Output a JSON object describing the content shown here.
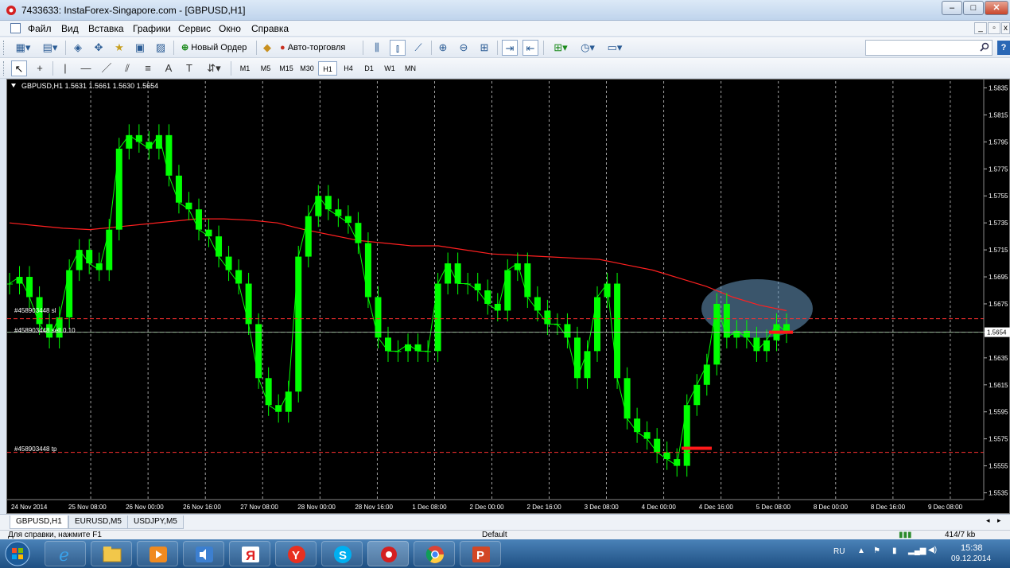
{
  "window": {
    "title": "7433633: InstaForex-Singapore.com - [GBPUSD,H1]"
  },
  "menu": {
    "items": [
      "Файл",
      "Вид",
      "Вставка",
      "Графики",
      "Сервис",
      "Окно",
      "Справка"
    ]
  },
  "toolbar": {
    "new_order": "Новый Ордер",
    "auto_trading": "Авто-торговля"
  },
  "timeframes": [
    "M1",
    "M5",
    "M15",
    "M30",
    "H1",
    "H4",
    "D1",
    "W1",
    "MN"
  ],
  "active_timeframe": "H1",
  "search": {
    "value": ""
  },
  "chart": {
    "header": "GBPUSD,H1  1.5631 1.5661 1.5630 1.5654",
    "current_price": "1.5654",
    "order_lines": {
      "sl_label": "#458903448 sl",
      "entry_label": "#458903448 sell 0.10",
      "tp_label": "#458903448 tp"
    },
    "colors": {
      "background": "#000000",
      "candles": "#00ff00",
      "moving_average": "#ff2020",
      "order_lines": "#ff3030",
      "bid_line": "#c0c0c0",
      "grid": "#c8c8c8",
      "highlight": "#6a9ac2"
    }
  },
  "chart_data": {
    "type": "line",
    "symbol": "GBPUSD",
    "timeframe": "H1",
    "y_ticks": [
      "1.5835",
      "1.5815",
      "1.5795",
      "1.5775",
      "1.5755",
      "1.5735",
      "1.5715",
      "1.5695",
      "1.5675",
      "1.5654",
      "1.5635",
      "1.5615",
      "1.5595",
      "1.5575",
      "1.5555",
      "1.5535"
    ],
    "x_ticks": [
      "24 Nov 2014",
      "25 Nov 08:00",
      "26 Nov 00:00",
      "26 Nov 16:00",
      "27 Nov 08:00",
      "28 Nov 00:00",
      "28 Nov 16:00",
      "1 Dec 08:00",
      "2 Dec 00:00",
      "2 Dec 16:00",
      "3 Dec 08:00",
      "4 Dec 00:00",
      "4 Dec 16:00",
      "5 Dec 08:00",
      "8 Dec 00:00",
      "8 Dec 16:00",
      "9 Dec 08:00"
    ],
    "ylim": [
      1.553,
      1.584
    ],
    "price_series": [
      1.569,
      1.5695,
      1.568,
      1.566,
      1.565,
      1.5665,
      1.57,
      1.5715,
      1.5705,
      1.57,
      1.573,
      1.579,
      1.58,
      1.5795,
      1.579,
      1.58,
      1.577,
      1.575,
      1.5745,
      1.573,
      1.5725,
      1.571,
      1.57,
      1.569,
      1.566,
      1.562,
      1.56,
      1.5595,
      1.561,
      1.571,
      1.574,
      1.5755,
      1.5745,
      1.574,
      1.5735,
      1.572,
      1.568,
      1.565,
      1.564,
      1.564,
      1.5645,
      1.564,
      1.564,
      1.569,
      1.5705,
      1.569,
      1.569,
      1.5685,
      1.5675,
      1.567,
      1.57,
      1.5705,
      1.568,
      1.567,
      1.566,
      1.566,
      1.565,
      1.562,
      1.564,
      1.568,
      1.569,
      1.562,
      1.559,
      1.558,
      1.5575,
      1.5565,
      1.556,
      1.5555,
      1.56,
      1.5615,
      1.563,
      1.5675,
      1.565,
      1.5655,
      1.565,
      1.564,
      1.5648,
      1.566,
      1.5654
    ],
    "ma_series": [
      1.5735,
      1.5733,
      1.5731,
      1.573,
      1.5732,
      1.5734,
      1.5736,
      1.5738,
      1.5738,
      1.5737,
      1.5735,
      1.573,
      1.5726,
      1.5722,
      1.572,
      1.5718,
      1.5718,
      1.5715,
      1.5712,
      1.5711,
      1.571,
      1.5709,
      1.5708,
      1.5704,
      1.57,
      1.5694,
      1.5688,
      1.568,
      1.5674,
      1.567
    ],
    "order_levels": {
      "sl": 1.5664,
      "entry": 1.5654,
      "tp": 1.5565
    },
    "bid": 1.5654,
    "grid": true,
    "highlight_region": "top-right"
  },
  "tabs": [
    "GBPUSD,H1",
    "EURUSD,M5",
    "USDJPY,M5"
  ],
  "active_tab": "GBPUSD,H1",
  "status": {
    "help": "Для справки, нажмите F1",
    "profile": "Default",
    "traffic": "414/7 kb"
  },
  "taskbar": {
    "language": "RU",
    "time": "15:38",
    "date": "09.12.2014",
    "apps": [
      "ie-icon",
      "explorer-icon",
      "media-player-icon",
      "volume-app-icon",
      "yandex-icon",
      "yandex-browser-icon",
      "skype-icon",
      "metatrader-icon",
      "chrome-icon",
      "powerpoint-icon"
    ]
  }
}
